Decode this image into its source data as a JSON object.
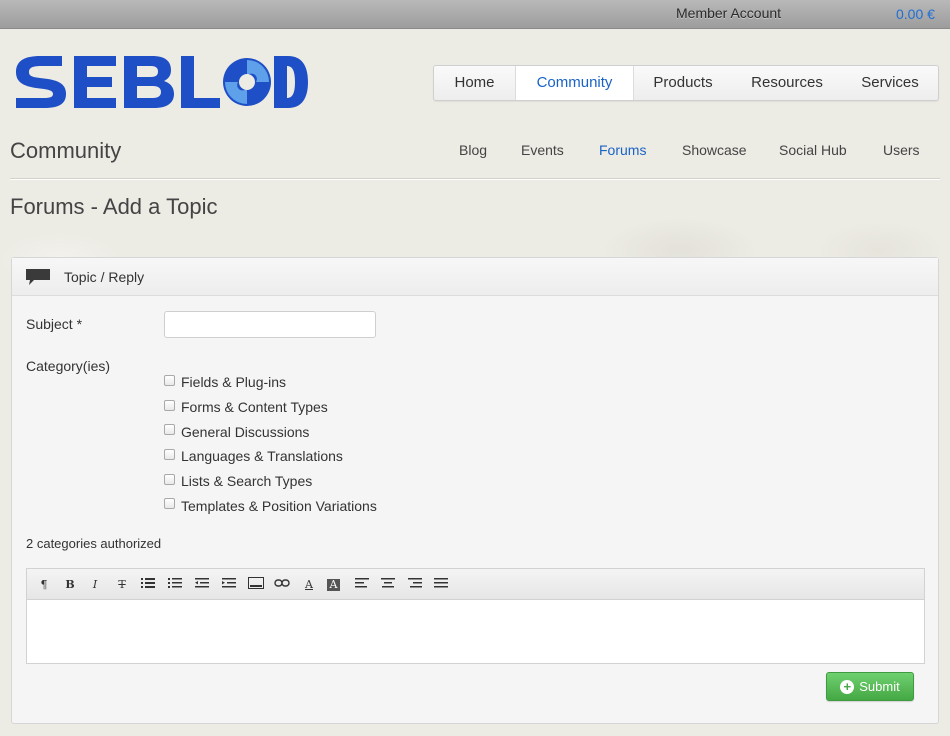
{
  "topbar": {
    "member_account": "Member Account",
    "cart_total": "0.00 €"
  },
  "logo": {
    "text": "SEBLOD",
    "color": "#1f4fc6"
  },
  "main_nav": {
    "items": [
      {
        "label": "Home",
        "active": false
      },
      {
        "label": "Community",
        "active": true
      },
      {
        "label": "Products",
        "active": false
      },
      {
        "label": "Resources",
        "active": false
      },
      {
        "label": "Services",
        "active": false
      }
    ]
  },
  "section": {
    "title": "Community"
  },
  "sub_nav": {
    "items": [
      {
        "label": "Blog",
        "active": false
      },
      {
        "label": "Events",
        "active": false
      },
      {
        "label": "Forums",
        "active": true
      },
      {
        "label": "Showcase",
        "active": false
      },
      {
        "label": "Social Hub",
        "active": false
      },
      {
        "label": "Users",
        "active": false
      }
    ]
  },
  "page": {
    "title": "Forums - Add a Topic"
  },
  "form": {
    "panel_title": "Topic / Reply",
    "subject_label": "Subject *",
    "subject_value": "",
    "category_label": "Category(ies)",
    "categories": [
      {
        "label": "Fields & Plug-ins",
        "checked": false
      },
      {
        "label": "Forms & Content Types",
        "checked": false
      },
      {
        "label": "General Discussions",
        "checked": false
      },
      {
        "label": "Languages & Translations",
        "checked": false
      },
      {
        "label": "Lists & Search Types",
        "checked": false
      },
      {
        "label": "Templates & Position Variations",
        "checked": false
      }
    ],
    "categories_note": "2 categories authorized",
    "editor_tools": [
      {
        "icon": "paragraph-icon",
        "glyph": "¶"
      },
      {
        "icon": "bold-icon",
        "glyph": "B"
      },
      {
        "icon": "italic-icon",
        "glyph": "I"
      },
      {
        "icon": "strikethrough-icon",
        "glyph": "T"
      },
      {
        "icon": "bullet-list-icon",
        "glyph": ""
      },
      {
        "icon": "numbered-list-icon",
        "glyph": ""
      },
      {
        "icon": "outdent-icon",
        "glyph": ""
      },
      {
        "icon": "indent-icon",
        "glyph": ""
      },
      {
        "icon": "image-icon",
        "glyph": ""
      },
      {
        "icon": "link-icon",
        "glyph": ""
      },
      {
        "icon": "text-color-icon",
        "glyph": "A"
      },
      {
        "icon": "background-color-icon",
        "glyph": "A"
      },
      {
        "icon": "align-left-icon",
        "glyph": ""
      },
      {
        "icon": "align-center-icon",
        "glyph": ""
      },
      {
        "icon": "align-right-icon",
        "glyph": ""
      },
      {
        "icon": "align-justify-icon",
        "glyph": ""
      }
    ],
    "submit_label": "Submit",
    "submit_color": "#44a844"
  },
  "colors": {
    "accent": "#1a63c6"
  }
}
